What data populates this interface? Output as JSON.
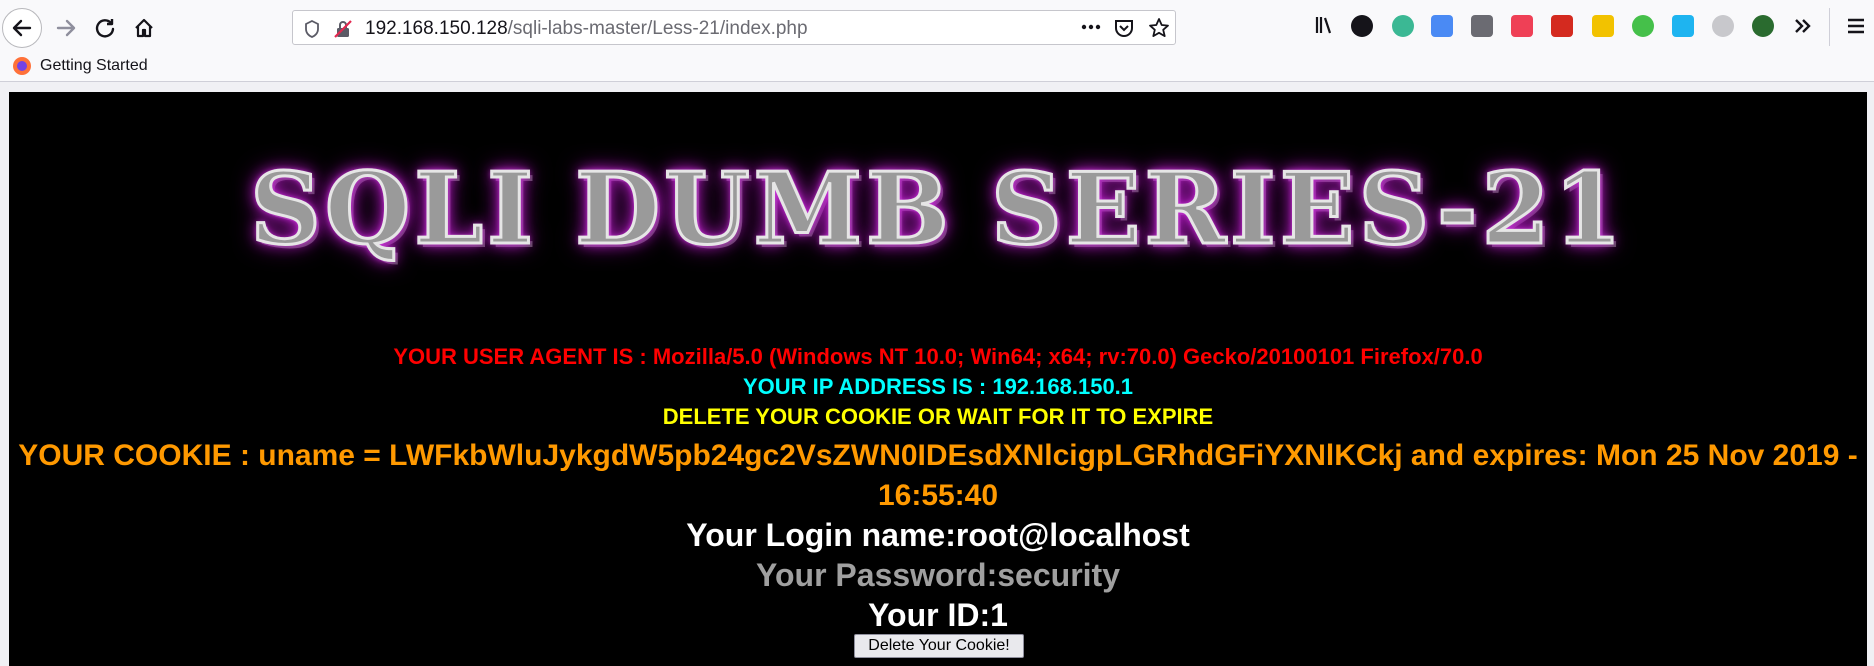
{
  "browser": {
    "url_host": "192.168.150.128",
    "url_path": "/sqli-labs-master/Less-21/index.php",
    "bookmarks": [
      {
        "label": "Getting Started"
      }
    ],
    "extension_icons": [
      "library-icon",
      "account-icon",
      "ext-green-icon",
      "translate-icon",
      "reader-icon",
      "pocket-icon",
      "pdf-icon",
      "ext-yellow-icon",
      "ext-m-icon",
      "ext-blue-icon",
      "ext-gray-icon",
      "ext-dark-green-icon"
    ]
  },
  "page": {
    "banner": "SQLI DUMB SERIES-21",
    "user_agent_line": "YOUR USER AGENT IS : Mozilla/5.0 (Windows NT 10.0; Win64; x64; rv:70.0) Gecko/20100101 Firefox/70.0",
    "ip_line": "YOUR IP ADDRESS IS : 192.168.150.1",
    "delete_hint": "DELETE YOUR COOKIE OR WAIT FOR IT TO EXPIRE",
    "cookie_line": "YOUR COOKIE : uname = LWFkbWluJykgdW5pb24gc2VsZWN0IDEsdXNlcigpLGRhdGFiYXNlKCkj and expires: Mon 25 Nov 2019 - 16:55:40",
    "login_line": "Your Login name:root@localhost",
    "password_line": "Your Password:security",
    "id_line": "Your ID:1",
    "delete_button": "Delete Your Cookie!"
  },
  "colors": {
    "user_agent": "#ff0000",
    "ip": "#00ffff",
    "delete_hint": "#ffff00",
    "cookie": "#ff9900",
    "banner_glow": "#c020d0"
  }
}
